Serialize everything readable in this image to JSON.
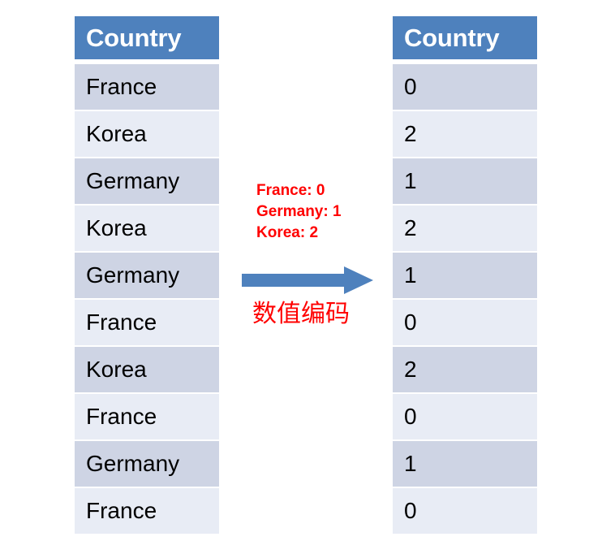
{
  "colors": {
    "header_blue": "#4e81bd",
    "row_dark": "#ced4e4",
    "row_light": "#e8ecf5",
    "annotation_red": "#ff0000",
    "arrow_blue": "#4e81bd",
    "text_black": "#000000",
    "header_text": "#ffffff",
    "background": "#ffffff"
  },
  "source_table": {
    "header": "Country",
    "rows": [
      "France",
      "Korea",
      "Germany",
      "Korea",
      "Germany",
      "France",
      "Korea",
      "France",
      "Germany",
      "France"
    ]
  },
  "encoded_table": {
    "header": "Country",
    "rows": [
      "0",
      "2",
      "1",
      "2",
      "1",
      "0",
      "2",
      "0",
      "1",
      "0"
    ]
  },
  "annotation": {
    "mapping": [
      "France: 0",
      "Germany: 1",
      "Korea: 2"
    ],
    "arrow_icon": "arrow-right-icon",
    "caption": "数值编码"
  }
}
